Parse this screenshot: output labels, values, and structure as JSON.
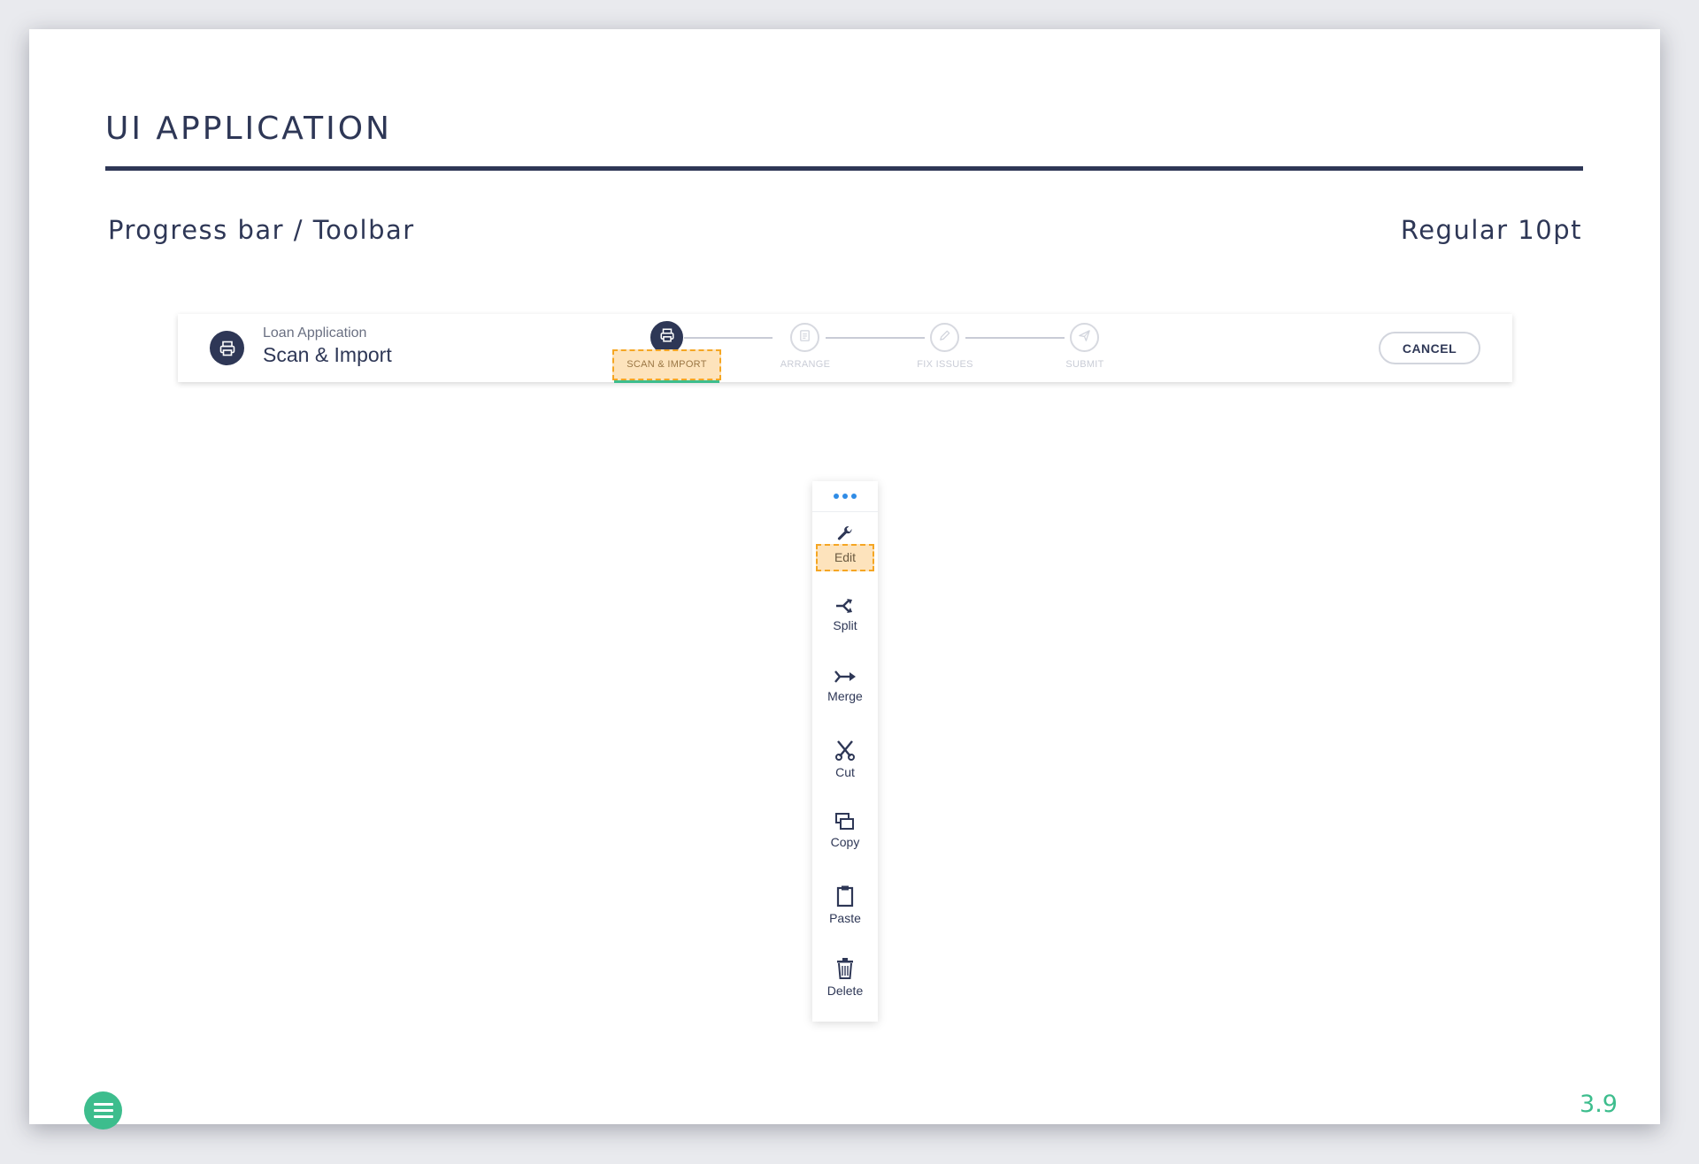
{
  "slide": {
    "title": "UI APPLICATION",
    "section_label": "Progress bar / Toolbar",
    "font_spec": "Regular 10pt",
    "page_number": "3.9"
  },
  "progress_bar": {
    "app_icon": "printer-icon",
    "subtitle": "Loan Application",
    "title": "Scan & Import",
    "steps": [
      {
        "label": "SCAN & IMPORT",
        "icon": "printer-icon",
        "state": "active"
      },
      {
        "label": "ARRANGE",
        "icon": "document-icon",
        "state": "inactive"
      },
      {
        "label": "FIX ISSUES",
        "icon": "pencil-icon",
        "state": "inactive"
      },
      {
        "label": "SUBMIT",
        "icon": "send-icon",
        "state": "inactive"
      }
    ],
    "cancel_label": "CANCEL"
  },
  "toolbar": {
    "more_icon": "more-dots-icon",
    "tools": [
      {
        "label": "Edit",
        "icon": "wrench-icon",
        "highlighted": true
      },
      {
        "label": "Split",
        "icon": "split-icon"
      },
      {
        "label": "Merge",
        "icon": "merge-icon"
      },
      {
        "label": "Cut",
        "icon": "scissors-icon"
      },
      {
        "label": "Copy",
        "icon": "copy-icon"
      },
      {
        "label": "Paste",
        "icon": "clipboard-icon"
      },
      {
        "label": "Delete",
        "icon": "trash-icon"
      }
    ]
  },
  "colors": {
    "navy": "#2e3756",
    "accent_green": "#3dbd8d",
    "highlight_fill": "#fde3bc",
    "highlight_border": "#f5a623",
    "dots_blue": "#2f8ce6"
  }
}
